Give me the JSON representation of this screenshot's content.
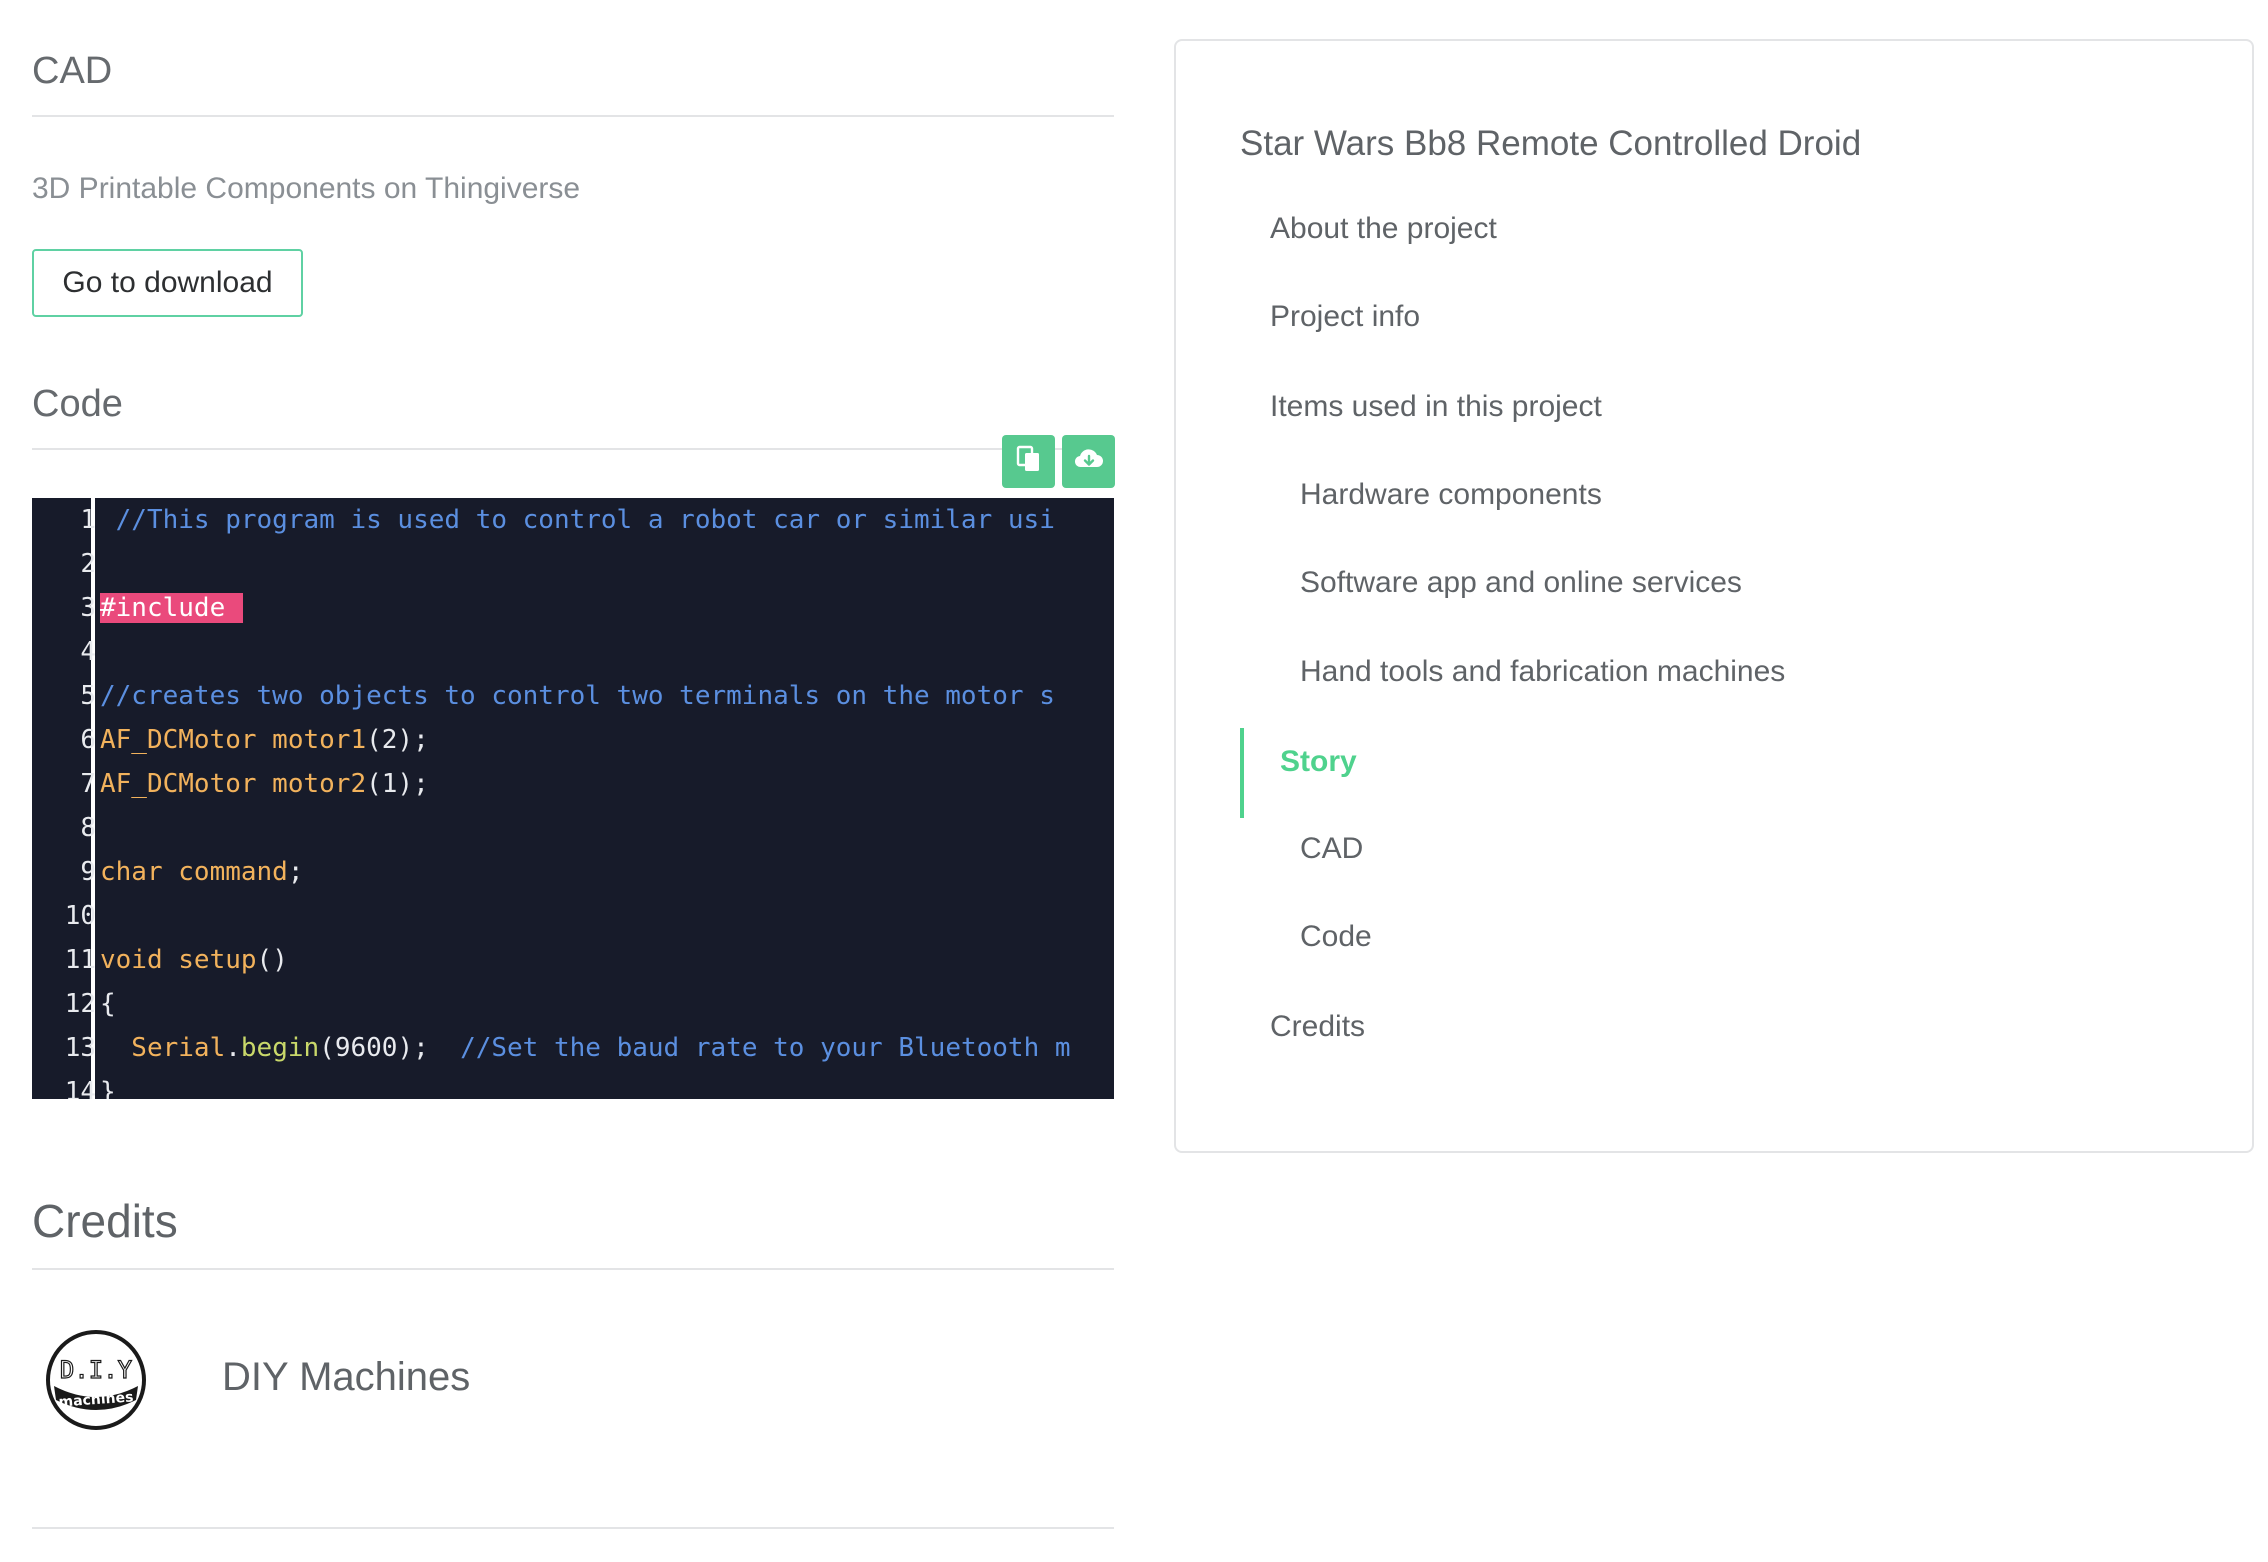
{
  "cad": {
    "heading": "CAD",
    "subtitle": "3D Printable Components on Thingiverse",
    "download_label": "Go to download"
  },
  "code_section": {
    "heading": "Code",
    "copy_icon": "copy-icon",
    "download_icon": "cloud-download-icon",
    "lines": [
      {
        "n": "1",
        "parts": [
          {
            "t": " //This program is used to control a robot car or similar usi",
            "c": "com"
          }
        ]
      },
      {
        "n": "2",
        "parts": []
      },
      {
        "n": "3",
        "parts": [
          {
            "t": "#include",
            "c": "inc"
          }
        ]
      },
      {
        "n": "4",
        "parts": []
      },
      {
        "n": "5",
        "parts": [
          {
            "t": "//creates two objects to control two terminals on the motor s",
            "c": "com"
          }
        ]
      },
      {
        "n": "6",
        "parts": [
          {
            "t": "AF_DCMotor motor1",
            "c": "kw"
          },
          {
            "t": "(2);",
            "c": "txt"
          }
        ]
      },
      {
        "n": "7",
        "parts": [
          {
            "t": "AF_DCMotor motor2",
            "c": "kw"
          },
          {
            "t": "(1);",
            "c": "txt"
          }
        ]
      },
      {
        "n": "8",
        "parts": []
      },
      {
        "n": "9",
        "parts": [
          {
            "t": "char command",
            "c": "kw"
          },
          {
            "t": ";",
            "c": "txt"
          }
        ]
      },
      {
        "n": "10",
        "parts": []
      },
      {
        "n": "11",
        "parts": [
          {
            "t": "void setup",
            "c": "kw"
          },
          {
            "t": "()",
            "c": "txt"
          }
        ]
      },
      {
        "n": "12",
        "parts": [
          {
            "t": "{",
            "c": "txt"
          }
        ]
      },
      {
        "n": "13",
        "parts": [
          {
            "t": "  Serial",
            "c": "kw"
          },
          {
            "t": ".",
            "c": "txt"
          },
          {
            "t": "begin",
            "c": "fn"
          },
          {
            "t": "(9600);  ",
            "c": "txt"
          },
          {
            "t": "//Set the baud rate to your Bluetooth m",
            "c": "com"
          }
        ]
      },
      {
        "n": "14",
        "parts": [
          {
            "t": "}",
            "c": "txt"
          }
        ]
      }
    ]
  },
  "credits": {
    "heading": "Credits",
    "name": "DIY Machines",
    "logo_text_top": "D.I.Y",
    "logo_text_bottom": "machines"
  },
  "sidebar": {
    "title": "Star Wars Bb8 Remote Controlled Droid",
    "items": [
      {
        "label": "About the project",
        "level": 1,
        "active": false
      },
      {
        "label": "Project info",
        "level": 1,
        "active": false
      },
      {
        "label": "Items used in this project",
        "level": 1,
        "active": false
      },
      {
        "label": "Hardware components",
        "level": 2,
        "active": false
      },
      {
        "label": "Software app and online services",
        "level": 2,
        "active": false
      },
      {
        "label": "Hand tools and fabrication machines",
        "level": 2,
        "active": false
      },
      {
        "label": "Story",
        "level": 1,
        "active": true
      },
      {
        "label": "CAD",
        "level": 2,
        "active": false
      },
      {
        "label": "Code",
        "level": 2,
        "active": false
      },
      {
        "label": "Credits",
        "level": 1,
        "active": false
      }
    ]
  },
  "colors": {
    "accent": "#4fd28d",
    "button_green": "#57c98f",
    "code_bg": "#171b2a"
  }
}
